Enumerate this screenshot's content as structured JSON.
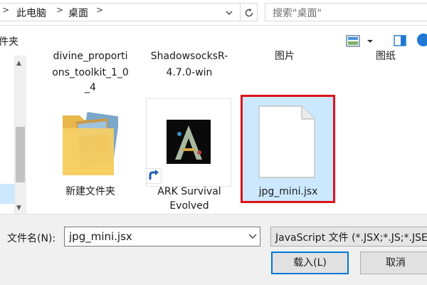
{
  "address": {
    "breadcrumbs": [
      "此电脑",
      "桌面"
    ],
    "separator": ">",
    "search_placeholder": "搜索\"桌面\""
  },
  "toolbar": {
    "new_folder_label": "件夹",
    "view_icon": "view-mode-icon",
    "pane_icon": "preview-pane-icon",
    "help_icon": "help-icon"
  },
  "files": [
    {
      "name": "divine_proportions_toolkit_1_0_4",
      "lines": [
        "divine_proporti",
        "ons_toolkit_1_0",
        "_4"
      ],
      "icon": "",
      "selected": false,
      "partial": true
    },
    {
      "name": "ShadowsocksR-4.7.0-win",
      "lines": [
        "ShadowsocksR-",
        "4.7.0-win"
      ],
      "icon": "",
      "selected": false,
      "partial": true
    },
    {
      "name": "图片",
      "lines": [
        "图片"
      ],
      "icon": "",
      "selected": false,
      "partial": true
    },
    {
      "name": "图纸",
      "lines": [
        "图纸"
      ],
      "icon": "",
      "selected": false,
      "partial": true
    },
    {
      "name": "新建文件夹",
      "lines": [
        "新建文件夹"
      ],
      "icon": "folder-with-photos-icon",
      "selected": false
    },
    {
      "name": "ARK Survival Evolved",
      "lines": [
        "ARK Survival",
        "Evolved"
      ],
      "icon": "ark-shortcut-icon",
      "selected": false
    },
    {
      "name": "jpg_mini.jsx",
      "lines": [
        "jpg_mini.jsx"
      ],
      "icon": "blank-document-icon",
      "selected": true
    }
  ],
  "bottom": {
    "filename_label": "文件名(N):",
    "filename_value": "jpg_mini.jsx",
    "filetype_value": "JavaScript 文件 (*.JSX;*.JS;*.JSE",
    "open_button": "载入(L)",
    "cancel_button": "取消"
  },
  "colors": {
    "selection": "#cce8ff",
    "highlight_border": "#e0121a",
    "default_button_border": "#0078d7",
    "help_blue": "#1e78d4"
  }
}
